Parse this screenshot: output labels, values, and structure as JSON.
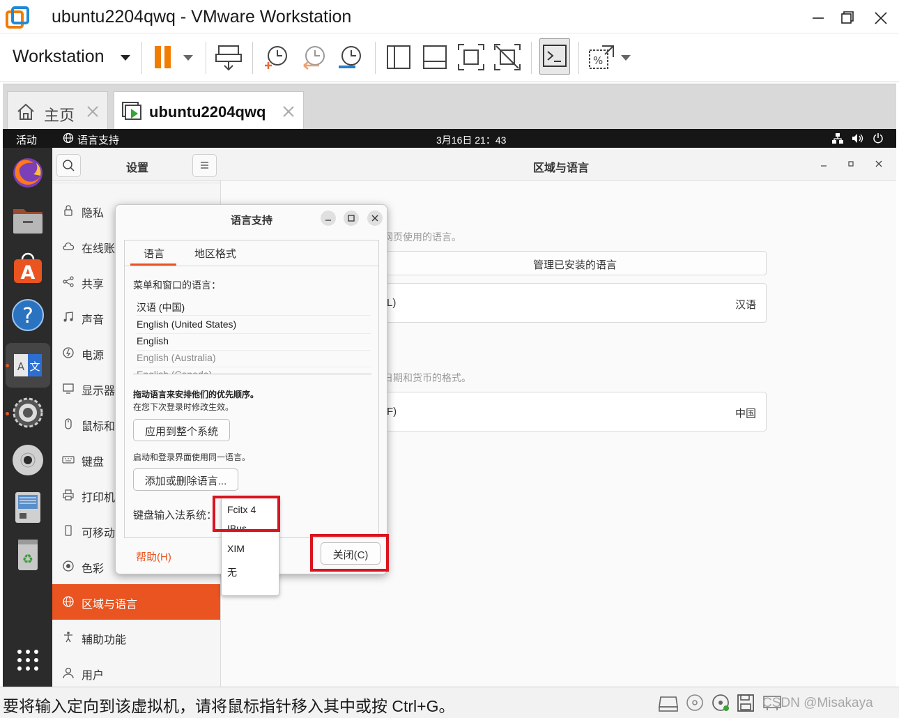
{
  "window": {
    "title": "ubuntu2204qwq - VMware Workstation"
  },
  "toolbar": {
    "workstation_label": "Workstation"
  },
  "tabs": [
    {
      "label": "主页"
    },
    {
      "label": "ubuntu2204qwq"
    }
  ],
  "ubuntu_topbar": {
    "activities": "活动",
    "app_menu": "语言支持",
    "clock": "3月16日  21：43"
  },
  "settings": {
    "header_title": "设置",
    "page_title": "区域与语言",
    "sidebar": [
      {
        "label": "隐私",
        "icon": "lock-icon"
      },
      {
        "label": "在线账户",
        "icon": "cloud-icon"
      },
      {
        "label": "共享",
        "icon": "share-icon"
      },
      {
        "label": "声音",
        "icon": "music-note-icon"
      },
      {
        "label": "电源",
        "icon": "power-icon"
      },
      {
        "label": "显示器",
        "icon": "display-icon"
      },
      {
        "label": "鼠标和触摸板",
        "icon": "mouse-icon"
      },
      {
        "label": "键盘",
        "icon": "keyboard-icon"
      },
      {
        "label": "打印机",
        "icon": "printer-icon"
      },
      {
        "label": "可移动介质",
        "icon": "removable-media-icon"
      },
      {
        "label": "色彩",
        "icon": "color-icon"
      },
      {
        "label": "区域与语言",
        "icon": "globe-icon",
        "active": true
      },
      {
        "label": "辅助功能",
        "icon": "accessibility-icon"
      },
      {
        "label": "用户",
        "icon": "user-icon"
      }
    ],
    "main": {
      "language_desc": "网页使用的语言。",
      "manage_button": "管理已安装的语言",
      "language_row_suffix": "L)",
      "language_value": "汉语",
      "formats_desc": "日期和货币的格式。",
      "formats_row_suffix": "F)",
      "formats_value": "中国"
    }
  },
  "language_dialog": {
    "title": "语言支持",
    "tabs": [
      "语言",
      "地区格式"
    ],
    "menu_lang_label": "菜单和窗口的语言：",
    "languages": [
      "汉语 (中国)",
      "English (United States)",
      "English",
      "English (Australia)",
      "English (Canada)"
    ],
    "drag_hint": "拖动语言来安排他们的优先顺序。",
    "drag_hint_sub": "在您下次登录时修改生效。",
    "apply_system_button": "应用到整个系统",
    "apply_hint": "启动和登录界面使用同一语言。",
    "add_remove_button": "添加或删除语言...",
    "im_label": "键盘输入法系统：",
    "help_button": "帮助(H)",
    "close_button": "关闭(C)",
    "im_options": [
      "Fcitx 4",
      "IBus",
      "XIM",
      "无"
    ],
    "im_selected": "Fcitx 4"
  },
  "statusbar": {
    "message": "要将输入定向到该虚拟机，请将鼠标指针移入其中或按 Ctrl+G。",
    "watermark": "CSDN @Misakaya"
  },
  "colors": {
    "ubuntu_orange": "#e95420",
    "vmware_orange": "#f07c00",
    "highlight_red": "#d9141e"
  }
}
